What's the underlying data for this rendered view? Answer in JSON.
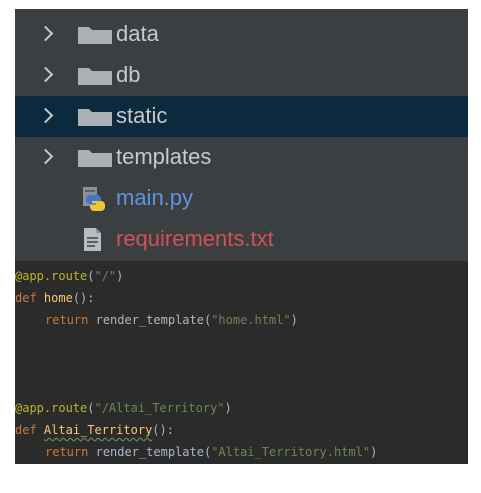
{
  "colors": {
    "tree_background": "#3c3f41",
    "selected_row": "#0d293e",
    "editor_background": "#2b2b2b",
    "folder_icon": "#a9b1b7",
    "python_file": "#5d94e0",
    "error_file": "#d25252",
    "keyword": "#cc7832",
    "decorator": "#bbb529",
    "function_name": "#ffc66d",
    "string": "#6a8759",
    "text": "#a9b7c6"
  },
  "project_tree": {
    "items": [
      {
        "type": "folder",
        "label": "data",
        "icon": "folder-icon",
        "expandable": true,
        "selected": false
      },
      {
        "type": "folder",
        "label": "db",
        "icon": "folder-icon",
        "expandable": true,
        "selected": false
      },
      {
        "type": "folder",
        "label": "static",
        "icon": "folder-icon",
        "expandable": true,
        "selected": true
      },
      {
        "type": "folder",
        "label": "templates",
        "icon": "folder-icon",
        "expandable": true,
        "selected": false
      },
      {
        "type": "file",
        "label": "main.py",
        "icon": "python-file-icon",
        "expandable": false,
        "selected": false
      },
      {
        "type": "file",
        "label": "requirements.txt",
        "icon": "text-file-icon",
        "expandable": false,
        "selected": false
      }
    ]
  },
  "code": {
    "line1": {
      "decorator": "@app.route",
      "open": "(",
      "string": "\"/\"",
      "close": ")"
    },
    "line2": {
      "keyword": "def",
      "name": "home",
      "rest": "():"
    },
    "line3": {
      "keyword": "return",
      "call": "render_template(",
      "string": "\"home.html\"",
      "close": ")"
    },
    "line4": {
      "decorator": "@app.route",
      "open": "(",
      "string": "\"/Altai_Territory\"",
      "close": ")"
    },
    "line5": {
      "keyword": "def",
      "name": "Altai_Territory",
      "rest": "():"
    },
    "line6": {
      "keyword": "return",
      "call": "render_template(",
      "string": "\"Altai_Territory.html\"",
      "close": ")"
    }
  }
}
